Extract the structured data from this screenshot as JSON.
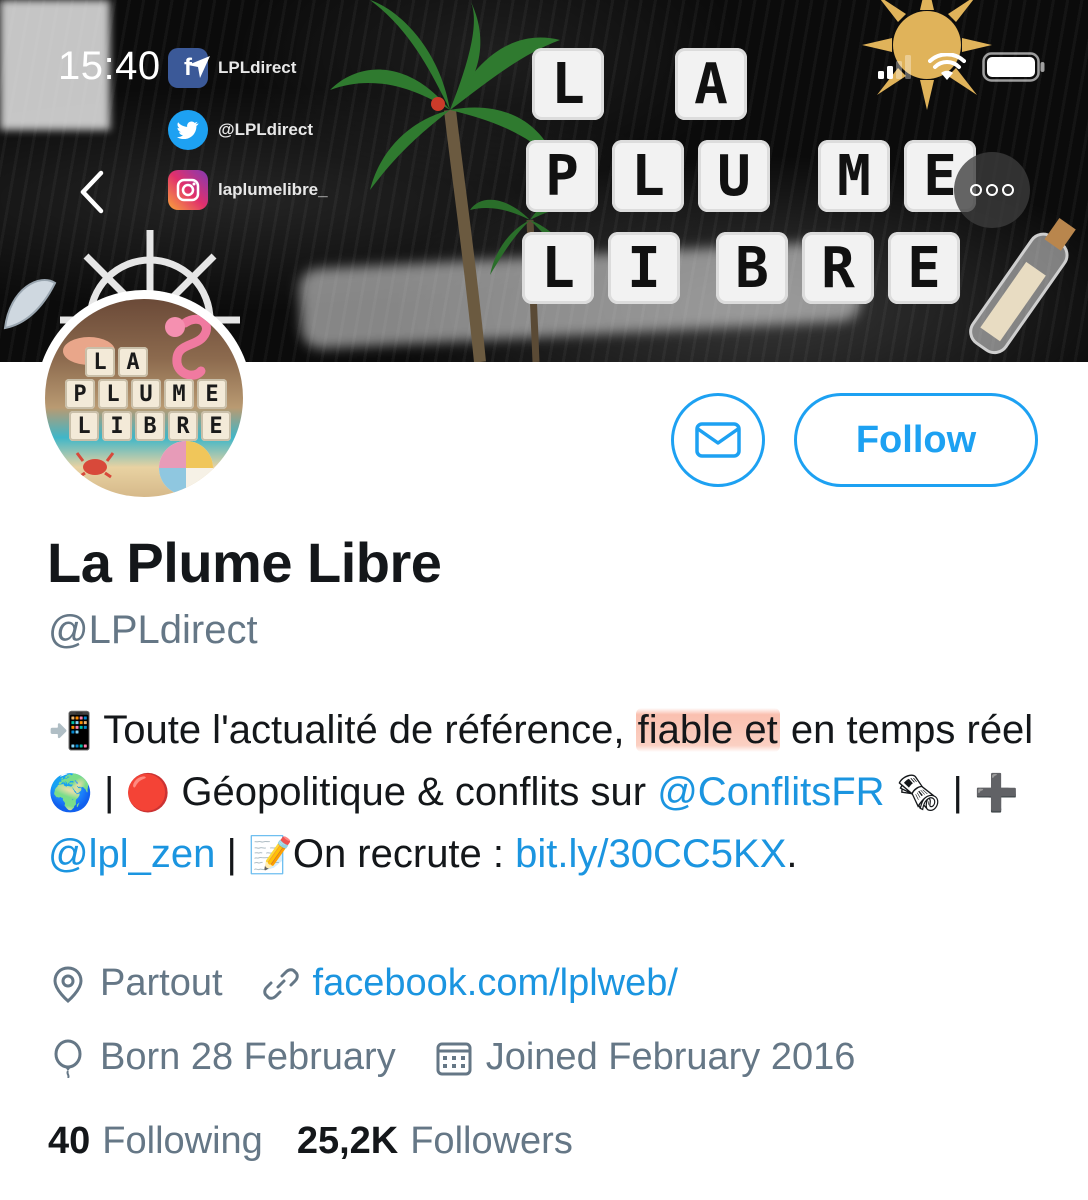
{
  "status_bar": {
    "time": "15:40",
    "location_icon": "location-arrow-icon",
    "signal_icon": "cellular-signal-icon",
    "wifi_icon": "wifi-icon",
    "battery_icon": "battery-icon"
  },
  "banner": {
    "logo_rows": [
      [
        "L",
        "A"
      ],
      [
        "P",
        "L",
        "U",
        "M",
        "E"
      ],
      [
        "L",
        "I",
        "B",
        "R",
        "E"
      ]
    ],
    "socials": [
      {
        "network": "facebook",
        "icon": "facebook-icon",
        "label": "LPLdirect"
      },
      {
        "network": "twitter",
        "icon": "twitter-icon",
        "label": "@LPLdirect"
      },
      {
        "network": "instagram",
        "icon": "instagram-icon",
        "label": "laplumelibre_"
      }
    ]
  },
  "avatar": {
    "tiles": [
      [
        "L",
        "A"
      ],
      [
        "P",
        "L",
        "U",
        "M",
        "E"
      ],
      [
        "L",
        "I",
        "B",
        "R",
        "E"
      ]
    ]
  },
  "actions": {
    "follow_label": "Follow",
    "message_icon": "envelope-icon"
  },
  "profile": {
    "display_name": "La Plume Libre",
    "handle": "@LPLdirect",
    "bio": {
      "emoji_phone": "📲",
      "text_1": " Toute l'actualité de référence, ",
      "highlighted": "fiable et",
      "text_2": " en temps réel ",
      "emoji_globe": "🌍",
      "sep_1": " | ",
      "emoji_red_circle": "🔴",
      "text_3": " Géopolitique & conflits sur ",
      "mention_1": "@ConflitsFR",
      "emoji_newspaper": "🗞",
      "sep_2": " | ",
      "emoji_plus": "➕",
      "mention_2": "@lpl_zen",
      "sep_3": " | ",
      "emoji_memo": "📝",
      "text_4": "On recrute : ",
      "link": "bit.ly/30CC5KX",
      "text_5": "."
    },
    "location": "Partout",
    "website": "facebook.com/lplweb/",
    "birthday": "Born 28 February",
    "joined": "Joined February 2016"
  },
  "stats": {
    "following_count": "40",
    "following_label": "Following",
    "followers_count": "25,2K",
    "followers_label": "Followers"
  },
  "colors": {
    "accent": "#1da1f2",
    "link": "#1b95e0",
    "secondary_text": "#657786",
    "highlight": "#f68c6e"
  }
}
